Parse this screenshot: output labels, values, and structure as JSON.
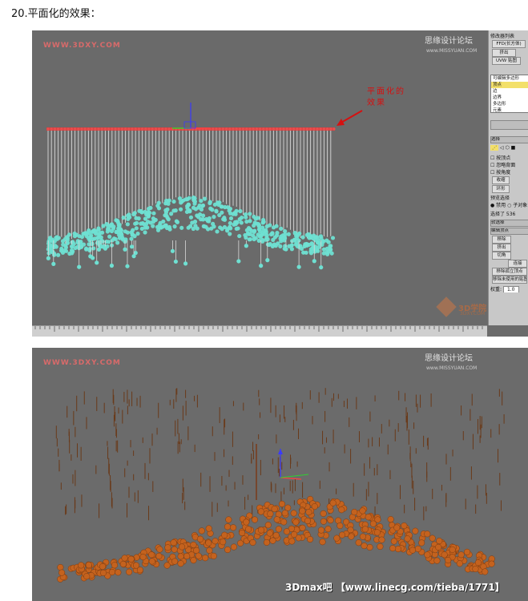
{
  "heading": "20.平面化的效果：",
  "panels": [
    {
      "watermark_left": "WWW.3DXY.COM",
      "watermark_right": "思缘设计论坛",
      "watermark_right_small": "www.MISSYUAN.COM",
      "annotation_line1": "平面化的",
      "annotation_line2": "效果",
      "brand_text": "3D学院",
      "brand_sub": "3DXY.COM",
      "command_panel": {
        "modifier_list": "修改器列表",
        "ffd_button": "FFD(长方体)",
        "btn_small": "挤出",
        "uvw_button": "UVW 贴图",
        "stack_items": [
          "可编辑多边形",
          "顶点",
          "边",
          "边界",
          "多边形",
          "元素"
        ],
        "selected_stack_item": "顶点",
        "rollout_select": "选择",
        "check_by_vertex": "按顶点",
        "check_ignore_back": "忽略背面",
        "check_by_angle": "按角度",
        "btn_shrink": "收缩",
        "btn_ring": "环形",
        "preview_selection": "预览选择",
        "radio_disabled": "禁用",
        "radio_subobject": "子对象",
        "selected_count": "选择了 536",
        "rollout_soft": "软选择",
        "rollout_edit_vertex": "编辑顶点",
        "btn_remove": "移除",
        "btn_extrude": "挤出",
        "btn_chamfer": "切角",
        "btn_connect": "连接",
        "btn_remove_isolated": "移除孤立顶点",
        "btn_remove_unused": "移除未使用的贴图",
        "weight_label": "权重:",
        "weight_value": "1.0"
      }
    },
    {
      "watermark_left": "WWW.3DXY.COM",
      "watermark_right": "思缘设计论坛",
      "watermark_right_small": "www.MISSYUAN.COM",
      "footer": "3Dmax吧 【www.linecg.com/tieba/1771】"
    }
  ],
  "colors": {
    "viewport": "#6a6a6a",
    "spheres_top": "#6fe0d2",
    "spheres_bottom": "#c4621e",
    "plane_line": "#d84040",
    "annotation": "#d61010"
  }
}
